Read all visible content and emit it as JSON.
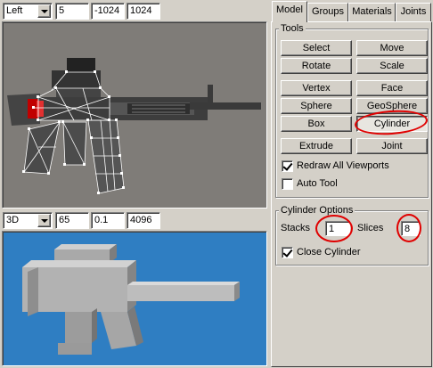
{
  "top_bar": {
    "view": "Left",
    "field1": "5",
    "field2": "-1024",
    "field3": "1024"
  },
  "mid_bar": {
    "view": "3D",
    "field1": "65",
    "field2": "0.1",
    "field3": "4096"
  },
  "tabs": [
    {
      "label": "Model"
    },
    {
      "label": "Groups"
    },
    {
      "label": "Materials"
    },
    {
      "label": "Joints"
    }
  ],
  "tools": {
    "title": "Tools",
    "buttons": {
      "select": "Select",
      "move": "Move",
      "rotate": "Rotate",
      "scale": "Scale",
      "vertex": "Vertex",
      "face": "Face",
      "sphere": "Sphere",
      "geosphere": "GeoSphere",
      "box": "Box",
      "cylinder": "Cylinder",
      "extrude": "Extrude",
      "joint": "Joint"
    },
    "redraw_label": "Redraw All Viewports",
    "auto_tool_label": "Auto Tool"
  },
  "cylinder_options": {
    "title": "Cylinder Options",
    "stacks_label": "Stacks",
    "stacks_value": "1",
    "slices_label": "Slices",
    "slices_value": "8",
    "close_label": "Close Cylinder"
  },
  "state": {
    "redraw_all_viewports": true,
    "auto_tool": false,
    "close_cylinder": true,
    "active_tab": "Model",
    "pressed_tool": "Cylinder"
  },
  "colors": {
    "annotation": "#e00000",
    "viewport_2d_bg": "#7f7c78",
    "viewport_3d_bg": "#2f7ec2"
  }
}
